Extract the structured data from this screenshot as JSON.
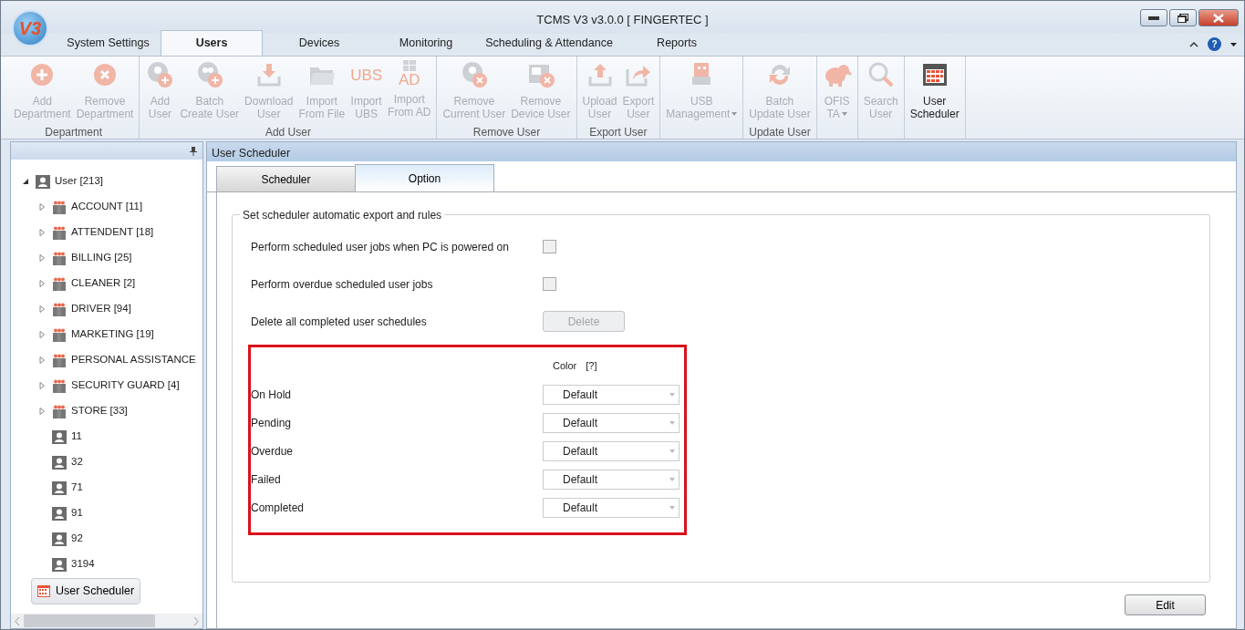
{
  "window": {
    "logo_text": "V3",
    "title": "TCMS V3 v3.0.0 [ FINGERTEC ]"
  },
  "menu_tabs": [
    {
      "label": "System Settings",
      "selected": false
    },
    {
      "label": "Users",
      "selected": true
    },
    {
      "label": "Devices",
      "selected": false
    },
    {
      "label": "Monitoring",
      "selected": false
    },
    {
      "label": "Scheduling & Attendance",
      "selected": false
    },
    {
      "label": "Reports",
      "selected": false
    }
  ],
  "help_glyph": "?",
  "ribbon": {
    "groups": [
      {
        "label": "Department",
        "buttons": [
          {
            "lines": [
              "Add",
              "Department"
            ],
            "kind": "plus",
            "disabled": true
          },
          {
            "lines": [
              "Remove",
              "Department"
            ],
            "kind": "cross",
            "disabled": true
          }
        ]
      },
      {
        "label": "Add User",
        "buttons": [
          {
            "lines": [
              "Add",
              "User"
            ],
            "kind": "user-plus",
            "disabled": true
          },
          {
            "lines": [
              "Batch",
              "Create User"
            ],
            "kind": "users-plus",
            "disabled": true
          },
          {
            "lines": [
              "Download",
              "User"
            ],
            "kind": "download",
            "disabled": true
          },
          {
            "lines": [
              "Import",
              "From File"
            ],
            "kind": "folder",
            "disabled": true
          },
          {
            "lines": [
              "Import",
              "UBS"
            ],
            "kind": "text",
            "icon_text": "UBS",
            "disabled": true
          },
          {
            "lines": [
              "Import",
              "From AD"
            ],
            "kind": "windows",
            "icon_text": "AD",
            "disabled": true
          }
        ]
      },
      {
        "label": "Remove User",
        "buttons": [
          {
            "lines": [
              "Remove",
              "Current User"
            ],
            "kind": "user-cross",
            "disabled": true
          },
          {
            "lines": [
              "Remove",
              "Device User"
            ],
            "kind": "device-cross",
            "disabled": true
          }
        ]
      },
      {
        "label": "Export User",
        "buttons": [
          {
            "lines": [
              "Upload",
              "User"
            ],
            "kind": "upload",
            "disabled": true
          },
          {
            "lines": [
              "Export",
              "User"
            ],
            "kind": "share",
            "disabled": true
          }
        ]
      },
      {
        "buttons": [
          {
            "lines": [
              "USB",
              "Management"
            ],
            "kind": "usb",
            "disabled": true,
            "dropdown": true
          }
        ]
      },
      {
        "label": "Update User",
        "buttons": [
          {
            "lines": [
              "Batch",
              "Update User"
            ],
            "kind": "refresh",
            "disabled": true
          }
        ]
      },
      {
        "buttons": [
          {
            "lines": [
              "OFIS",
              "TA"
            ],
            "kind": "animal",
            "disabled": true,
            "dropdown": true
          }
        ]
      },
      {
        "buttons": [
          {
            "lines": [
              "Search",
              "User"
            ],
            "kind": "search",
            "disabled": true
          }
        ]
      },
      {
        "buttons": [
          {
            "lines": [
              "User",
              "Scheduler"
            ],
            "kind": "calendar",
            "disabled": false
          }
        ]
      }
    ]
  },
  "tree": {
    "items": [
      {
        "label": "User [213]",
        "kind": "user",
        "expanded": true,
        "children": [
          {
            "label": "ACCOUNT [11]",
            "kind": "group",
            "expanded": false
          },
          {
            "label": "ATTENDENT [18]",
            "kind": "group",
            "expanded": false
          },
          {
            "label": "BILLING [25]",
            "kind": "group",
            "expanded": false
          },
          {
            "label": "CLEANER [2]",
            "kind": "group",
            "expanded": false
          },
          {
            "label": "DRIVER [94]",
            "kind": "group",
            "expanded": false
          },
          {
            "label": "MARKETING [19]",
            "kind": "group",
            "expanded": false
          },
          {
            "label": "PERSONAL ASSISTANCE",
            "kind": "group",
            "expanded": false
          },
          {
            "label": "SECURITY GUARD [4]",
            "kind": "group",
            "expanded": false
          },
          {
            "label": "STORE [33]",
            "kind": "group",
            "expanded": false
          },
          {
            "label": "11",
            "kind": "user"
          },
          {
            "label": "32",
            "kind": "user"
          },
          {
            "label": "71",
            "kind": "user"
          },
          {
            "label": "91",
            "kind": "user"
          },
          {
            "label": "92",
            "kind": "user"
          },
          {
            "label": "3194",
            "kind": "user"
          }
        ]
      }
    ],
    "footer_button": "User Scheduler"
  },
  "panel": {
    "title": "User Scheduler",
    "tabs": [
      {
        "label": "Scheduler",
        "selected": false
      },
      {
        "label": "Option",
        "selected": true
      }
    ],
    "legend": "Set scheduler automatic export and rules",
    "options": [
      {
        "label": "Perform scheduled user jobs when PC is powered on",
        "kind": "checkbox",
        "checked": false
      },
      {
        "label": "Perform overdue scheduled user jobs",
        "kind": "checkbox",
        "checked": false
      },
      {
        "label": "Delete all completed user schedules",
        "kind": "button",
        "button": "Delete",
        "disabled": true
      }
    ],
    "color_header": "Color",
    "color_help": "[?]",
    "statuses": [
      {
        "label": "On Hold",
        "value": "Default"
      },
      {
        "label": "Pending",
        "value": "Default"
      },
      {
        "label": "Overdue",
        "value": "Default"
      },
      {
        "label": "Failed",
        "value": "Default"
      },
      {
        "label": "Completed",
        "value": "Default"
      }
    ],
    "edit_button": "Edit"
  }
}
